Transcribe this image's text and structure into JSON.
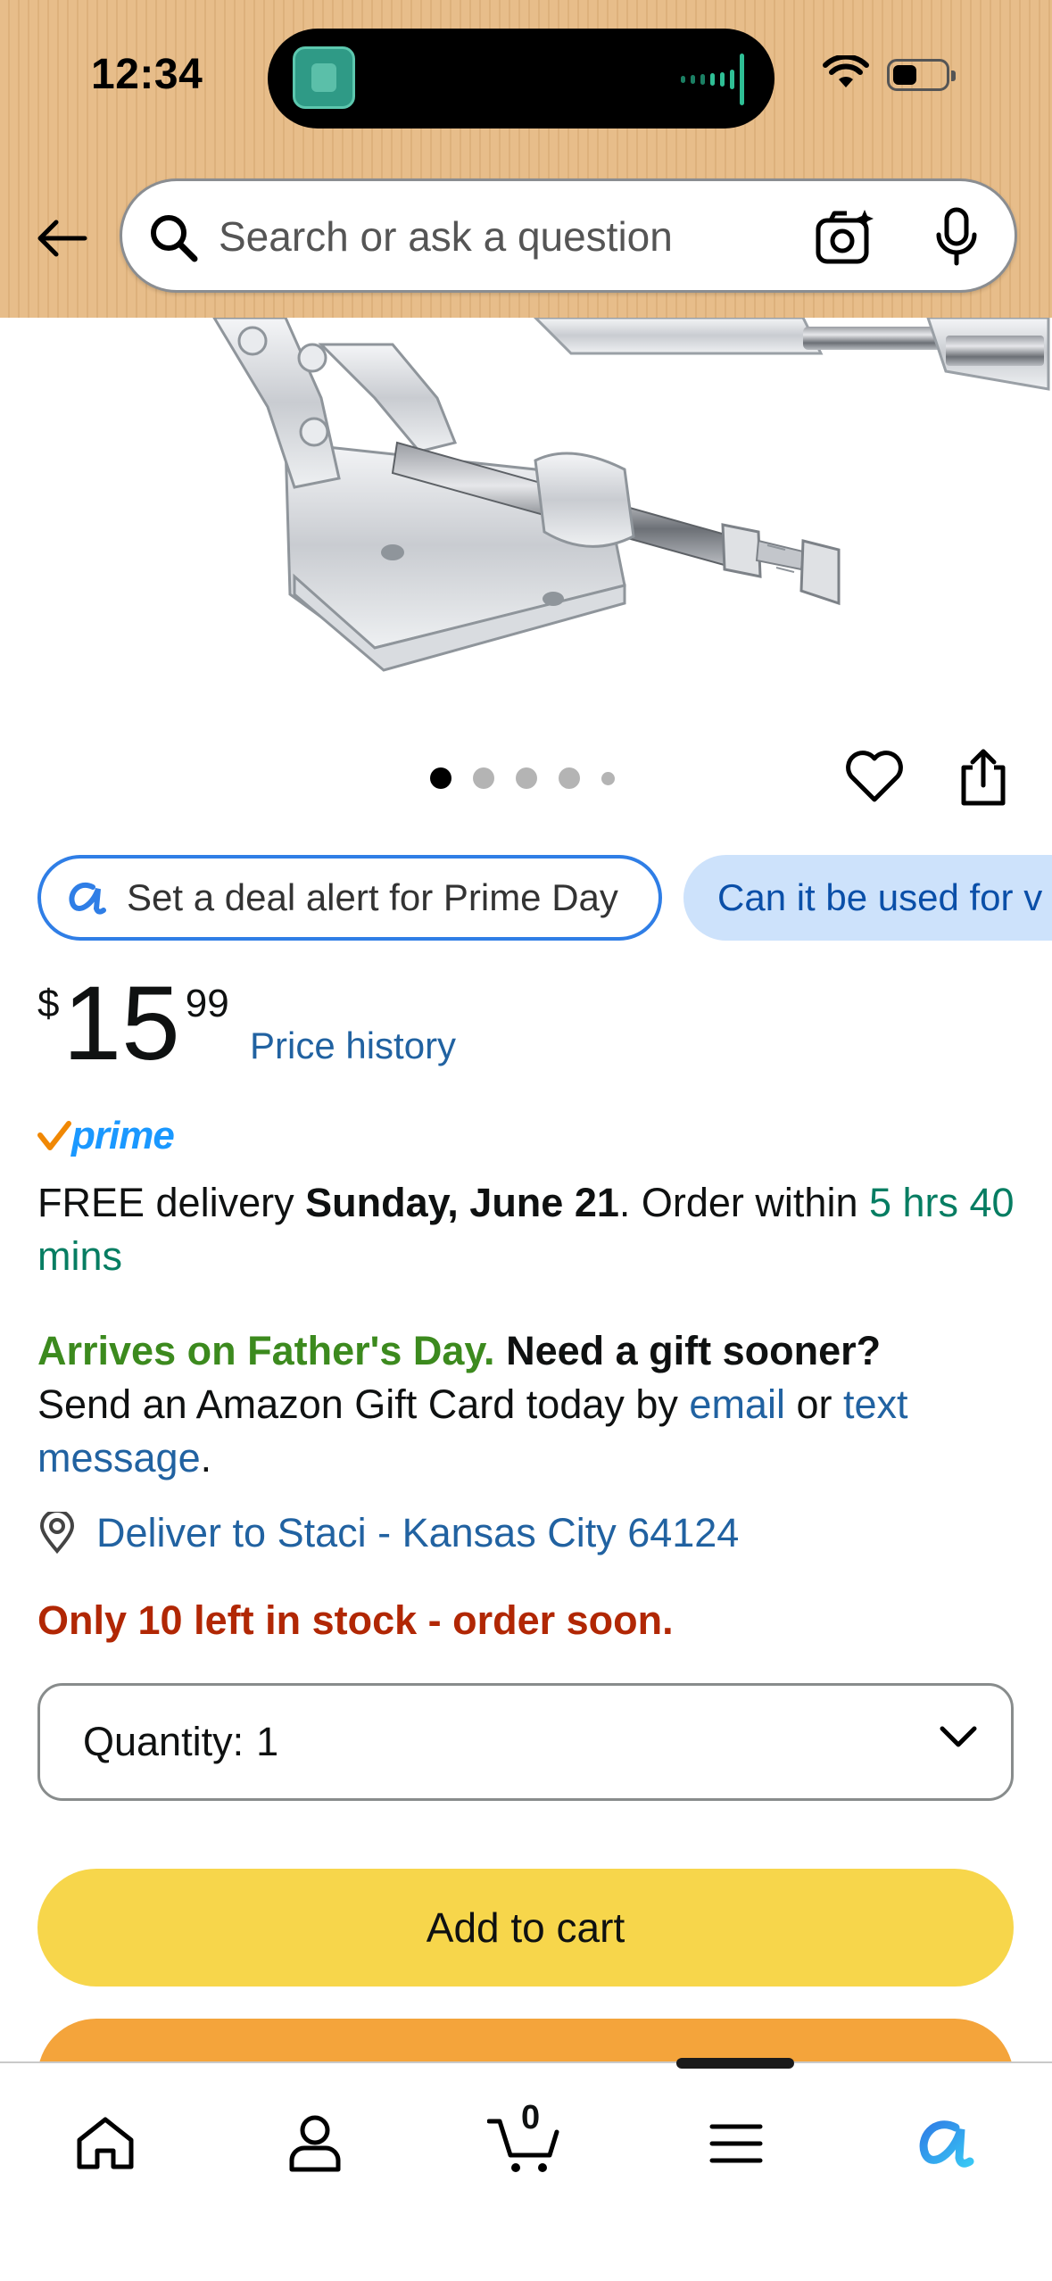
{
  "status_bar": {
    "time": "12:34"
  },
  "search": {
    "placeholder": "Search or ask a question",
    "back_icon": "back-arrow-icon",
    "search_icon": "magnifier-icon",
    "camera_icon": "camera-sparkle-icon",
    "mic_icon": "microphone-icon"
  },
  "carousel": {
    "total_dots": 5,
    "active_index": 0
  },
  "chips": {
    "deal_alert": "Set a deal alert for Prime Day",
    "question": "Can it be used for v"
  },
  "price": {
    "symbol": "$",
    "whole": "15",
    "fraction": "99",
    "history_link": "Price history"
  },
  "prime": {
    "label": "prime"
  },
  "delivery": {
    "prefix": "FREE delivery ",
    "date": "Sunday, June 21",
    "middle": ". Order within ",
    "countdown": "5 hrs 40 mins"
  },
  "gift": {
    "arrives": "Arrives on Father's Day.",
    "need_gift": " Need a gift sooner?",
    "line": "Send an Amazon Gift Card today by ",
    "email_link": "email",
    "or": " or ",
    "text_link": "text message",
    "period": "."
  },
  "deliver_to": {
    "label": "Deliver to Staci - Kansas City 64124"
  },
  "stock": {
    "message": "Only 10 left in stock - order soon."
  },
  "quantity": {
    "label": "Quantity:",
    "value": "1"
  },
  "buttons": {
    "add_to_cart": "Add to cart"
  },
  "bottom_nav": {
    "cart_count": "0",
    "items": [
      "home-icon",
      "profile-icon",
      "cart-icon",
      "menu-icon",
      "rufus-ai-icon"
    ]
  },
  "colors": {
    "header_bg": "#e7bd8a",
    "link": "#2162a1",
    "stock_red": "#b12704",
    "green": "#067d62",
    "add_to_cart": "#f7d64b",
    "buy_now": "#f4a43b",
    "prime_blue": "#1a98ff"
  }
}
